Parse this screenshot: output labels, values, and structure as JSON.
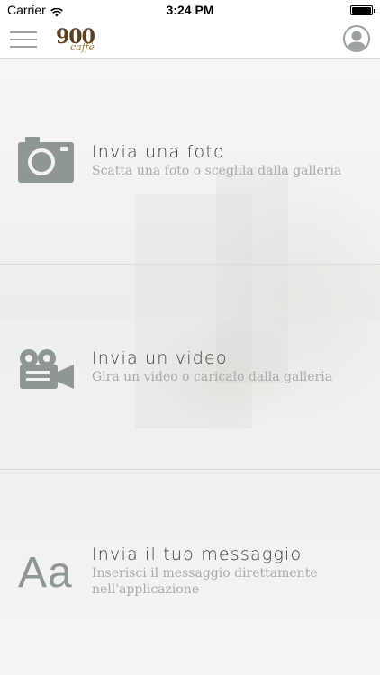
{
  "status_bar": {
    "carrier": "Carrier",
    "time": "3:24 PM"
  },
  "navbar": {
    "logo_number": "900",
    "logo_script": "caffè",
    "icons": {
      "menu": "hamburger-menu-icon",
      "profile": "user-profile-icon"
    }
  },
  "items": [
    {
      "icon": "camera-icon",
      "title": "Invia una foto",
      "subtitle": "Scatta una foto o sceglila dalla galleria"
    },
    {
      "icon": "video-camera-icon",
      "title": "Invia un video",
      "subtitle": "Gira un video o caricalo dalla galleria"
    },
    {
      "icon": "text-aa-icon",
      "icon_text": "Aa",
      "title": "Invia il tuo messaggio",
      "subtitle": "Inserisci il messaggio direttamente nell'applicazione"
    }
  ],
  "colors": {
    "icon_gray": "#8e9794",
    "title_text": "#3b3d3c",
    "subtitle_text": "#a8aba9",
    "divider": "#d8dcda",
    "logo_brown": "#5a3e1f"
  }
}
